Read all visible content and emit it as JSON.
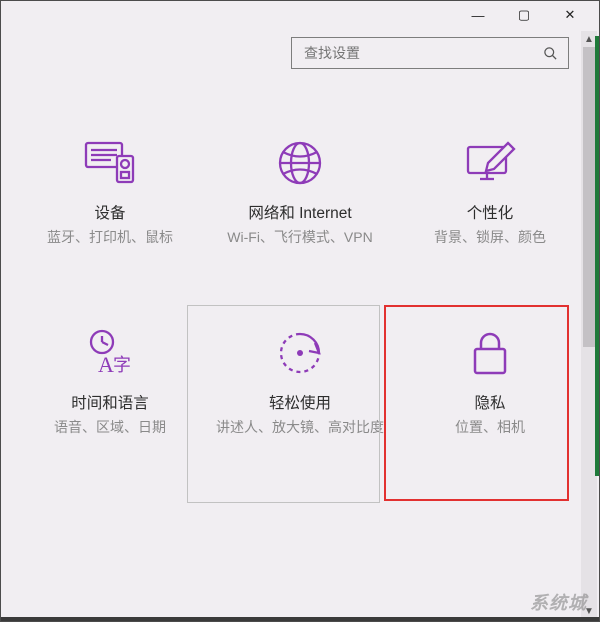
{
  "titlebar": {
    "minimize": "—",
    "maximize": "▢",
    "close": "✕"
  },
  "search": {
    "placeholder": "查找设置"
  },
  "accent_color": "#8e3bb8",
  "tiles": {
    "devices": {
      "icon": "devices-icon",
      "title": "设备",
      "desc": "蓝牙、打印机、鼠标"
    },
    "network": {
      "icon": "globe-icon",
      "title": "网络和 Internet",
      "desc": "Wi-Fi、飞行模式、VPN"
    },
    "personal": {
      "icon": "personalize-icon",
      "title": "个性化",
      "desc": "背景、锁屏、颜色"
    },
    "timelang": {
      "icon": "time-lang-icon",
      "title": "时间和语言",
      "desc": "语音、区域、日期"
    },
    "ease": {
      "icon": "ease-icon",
      "title": "轻松使用",
      "desc": "讲述人、放大镜、高对比度"
    },
    "privacy": {
      "icon": "lock-icon",
      "title": "隐私",
      "desc": "位置、相机"
    }
  },
  "ui_state": {
    "hovered": "ease",
    "highlighted": "privacy"
  },
  "watermark": "系统城"
}
